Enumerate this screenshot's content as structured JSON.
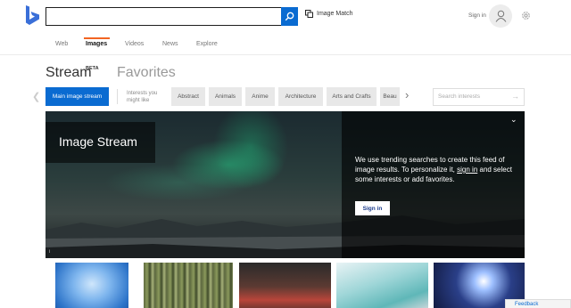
{
  "header": {
    "search_placeholder": "",
    "image_match_label": "Image Match",
    "sign_in_label": "Sign in"
  },
  "nav": {
    "items": [
      {
        "label": "Web"
      },
      {
        "label": "Images"
      },
      {
        "label": "Videos"
      },
      {
        "label": "News"
      },
      {
        "label": "Explore"
      }
    ],
    "active": "Images",
    "accent_color": "#f26522"
  },
  "stream": {
    "title": "Stream",
    "beta": "BETA",
    "favorites": "Favorites"
  },
  "interests": {
    "main_label": "Main image stream",
    "label": "Interests you might like",
    "chips": [
      "Abstract",
      "Animals",
      "Anime",
      "Architecture",
      "Arts and Crafts",
      "Beau"
    ],
    "search_placeholder": "Search interests"
  },
  "hero": {
    "label": "Image Stream",
    "message_part1": "We use trending searches to create this feed of image results. To personalize it, ",
    "message_link": "sign in",
    "message_part2": " and select some interests or add favorites.",
    "sign_in_button": "Sign in",
    "info_glyph": "i"
  },
  "footer": {
    "feedback_label": "Feedback"
  },
  "colors": {
    "brand_blue": "#0a6bd1",
    "accent_orange": "#f26522"
  }
}
